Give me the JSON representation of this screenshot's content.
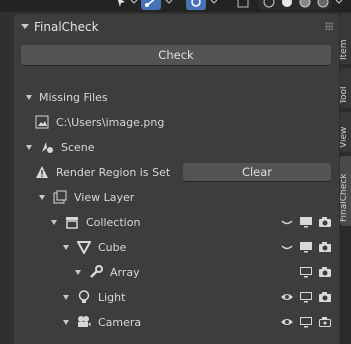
{
  "panel": {
    "title": "FinalCheck"
  },
  "check_button": {
    "label": "Check"
  },
  "tree": {
    "missing_files": {
      "label": "Missing Files"
    },
    "missing_file": {
      "label": "C:\\Users\\image.png"
    },
    "scene": {
      "label": "Scene"
    },
    "render_region": {
      "label": "Render Region is Set"
    },
    "clear_button": {
      "label": "Clear"
    },
    "view_layer": {
      "label": "View Layer"
    },
    "collection": {
      "label": "Collection"
    },
    "cube": {
      "label": "Cube"
    },
    "array": {
      "label": "Array"
    },
    "light": {
      "label": "Light"
    },
    "camera": {
      "label": "Camera"
    }
  },
  "side_tabs": {
    "item": "Item",
    "tool": "Tool",
    "view": "View",
    "finalcheck": "FinalCheck"
  },
  "icons": {
    "topbar": [
      "cursor-icon",
      "transform-icon",
      "snap-icon",
      "overlay-icon",
      "shading-icons"
    ],
    "row_right": [
      "selectable-icon",
      "viewport-icon",
      "render-icon",
      "eye-icon"
    ]
  },
  "colors": {
    "background": "#303030",
    "panel": "#3d3d3d",
    "button": "#545454",
    "accent_blue": "#4772b3",
    "warning": "#d8d8d8"
  }
}
